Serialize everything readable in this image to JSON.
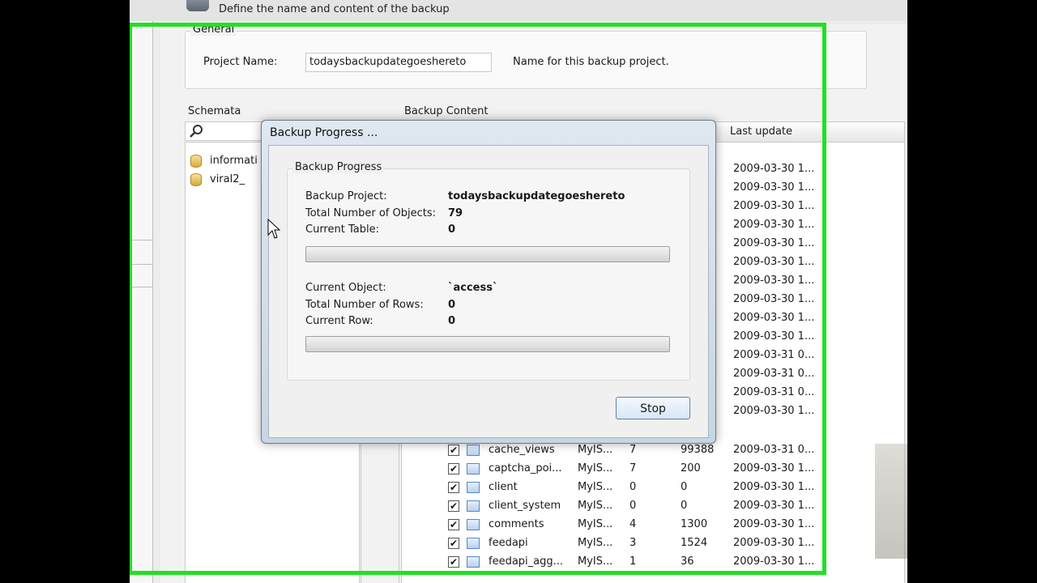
{
  "header": {
    "subtitle": "Define the name and content of the backup"
  },
  "general": {
    "legend": "General",
    "project_name_label": "Project Name:",
    "project_name_value": "todaysbackupdategoeshereto",
    "project_name_hint": "Name for this backup project."
  },
  "schemata": {
    "title": "Schemata",
    "items": [
      {
        "label": "informati"
      },
      {
        "label": "viral2_"
      }
    ]
  },
  "backup_content": {
    "title": "Backup Content",
    "last_update_header": "Last update",
    "hidden_dates": [
      "2009-03-30 1...",
      "2009-03-30 1...",
      "2009-03-30 1...",
      "2009-03-30 1...",
      "2009-03-30 1...",
      "2009-03-30 1...",
      "2009-03-30 1...",
      "2009-03-30 1...",
      "2009-03-30 1...",
      "2009-03-30 1...",
      "2009-03-31 0...",
      "2009-03-31 0...",
      "2009-03-31 0...",
      "2009-03-30 1..."
    ],
    "rows": [
      {
        "name": "cache_views",
        "engine": "MyIS...",
        "count": "7",
        "size": "99388",
        "date": "2009-03-31 0..."
      },
      {
        "name": "captcha_poi...",
        "engine": "MyIS...",
        "count": "7",
        "size": "200",
        "date": "2009-03-30 1..."
      },
      {
        "name": "client",
        "engine": "MyIS...",
        "count": "0",
        "size": "0",
        "date": "2009-03-30 1..."
      },
      {
        "name": "client_system",
        "engine": "MyIS...",
        "count": "0",
        "size": "0",
        "date": "2009-03-30 1..."
      },
      {
        "name": "comments",
        "engine": "MyIS...",
        "count": "4",
        "size": "1300",
        "date": "2009-03-30 1..."
      },
      {
        "name": "feedapi",
        "engine": "MyIS...",
        "count": "3",
        "size": "1524",
        "date": "2009-03-30 1..."
      },
      {
        "name": "feedapi_agg...",
        "engine": "MyIS...",
        "count": "1",
        "size": "36",
        "date": "2009-03-30 1..."
      }
    ]
  },
  "dialog": {
    "title": "Backup Progress ...",
    "group_legend": "Backup Progress",
    "backup_project_label": "Backup Project:",
    "backup_project_value": "todaysbackupdategoeshereto",
    "total_objects_label": "Total Number of Objects:",
    "total_objects_value": "79",
    "current_table_label": "Current Table:",
    "current_table_value": "0",
    "table_progress": 0,
    "current_object_label": "Current Object:",
    "current_object_value": "`access`",
    "total_rows_label": "Total Number of Rows:",
    "total_rows_value": "0",
    "current_row_label": "Current Row:",
    "current_row_value": "0",
    "row_progress": 0,
    "stop_label": "Stop"
  },
  "colors": {
    "highlight": "#22e022",
    "progress_fill": "#38b81c"
  }
}
